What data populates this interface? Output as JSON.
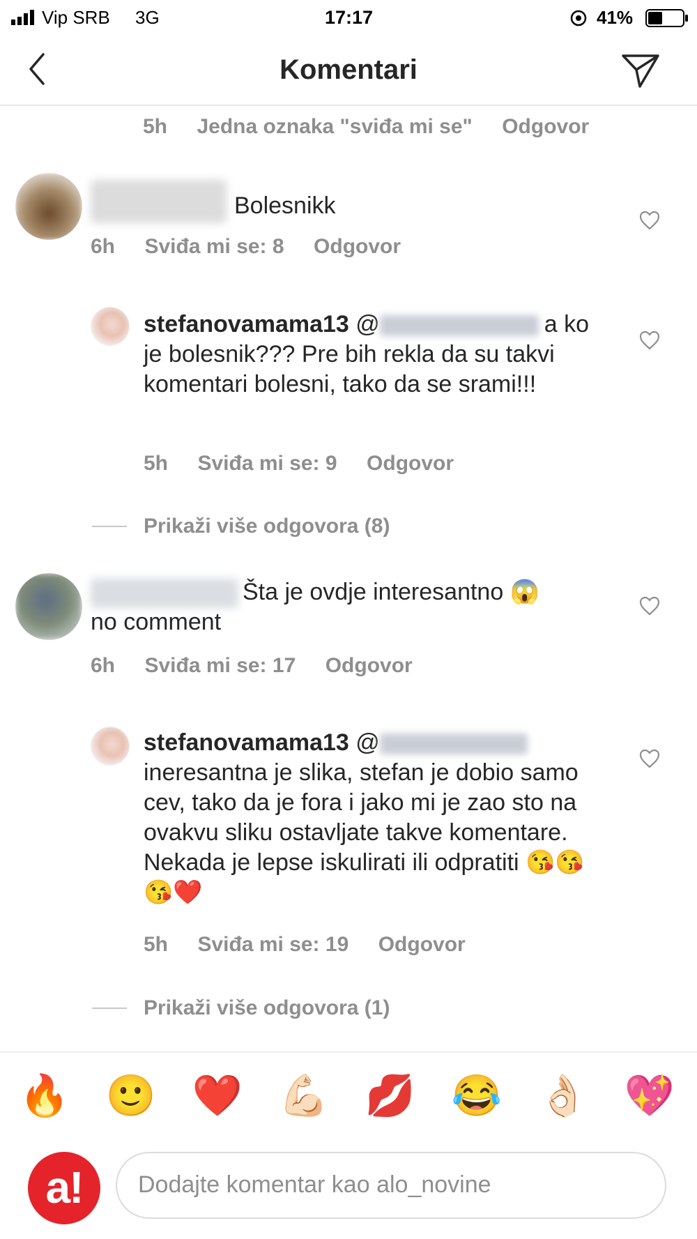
{
  "status_bar": {
    "carrier": "Vip SRB",
    "network": "3G",
    "time": "17:17",
    "battery_percent": "41%",
    "battery_level": 0.41
  },
  "header": {
    "title": "Komentari",
    "back_icon": "chevron-left-icon",
    "send_icon": "paper-plane-icon"
  },
  "top_meta": {
    "time": "5h",
    "likes": "Jedna oznaka \"sviđa mi se\"",
    "reply": "Odgovor"
  },
  "comments": [
    {
      "text": "Bolesnikk",
      "time": "6h",
      "likes": "Sviđa mi se: 8",
      "reply": "Odgovor"
    },
    {
      "username": "stefanovamama13",
      "mention_prefix": "@",
      "text_first": "a ko",
      "text_rest": "je bolesnik??? Pre bih rekla da su takvi komentari bolesni, tako da se srami!!!",
      "time": "5h",
      "likes": "Sviđa mi se: 9",
      "reply": "Odgovor"
    },
    {
      "more": "Prikaži više odgovora (8)"
    },
    {
      "text": "Šta je ovdje interesantno 😱",
      "text_line2": "no comment",
      "time": "6h",
      "likes": "Sviđa mi se: 17",
      "reply": "Odgovor"
    },
    {
      "username": "stefanovamama13",
      "mention_prefix": "@",
      "text": "ineresantna  je slika, stefan je dobio samo cev, tako da je fora i jako mi je zao sto na ovakvu sliku ostavljate takve komentare. Nekada je lepse iskulirati ili odpratiti 😘😘😘❤️",
      "time": "5h",
      "likes": "Sviđa mi se: 19",
      "reply": "Odgovor"
    },
    {
      "more": "Prikaži više odgovora (1)"
    }
  ],
  "emoji_bar": [
    "🔥",
    "🙂",
    "❤️",
    "💪🏻",
    "💋",
    "😂",
    "👌🏻",
    "💖"
  ],
  "composer": {
    "placeholder": "Dodajte komentar kao alo_novine",
    "avatar_text": "a!",
    "brand_color": "#e4232b"
  }
}
